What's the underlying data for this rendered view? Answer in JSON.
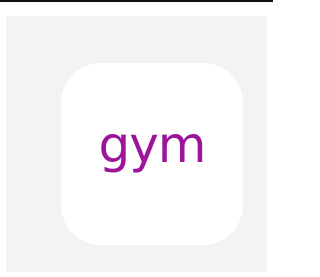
{
  "app_icon": {
    "logo_text": "gym",
    "colors": {
      "logo": "#9c159c",
      "icon_background": "#ffffff",
      "tile_background": "#f3f3f3",
      "top_border": "#111111"
    }
  }
}
